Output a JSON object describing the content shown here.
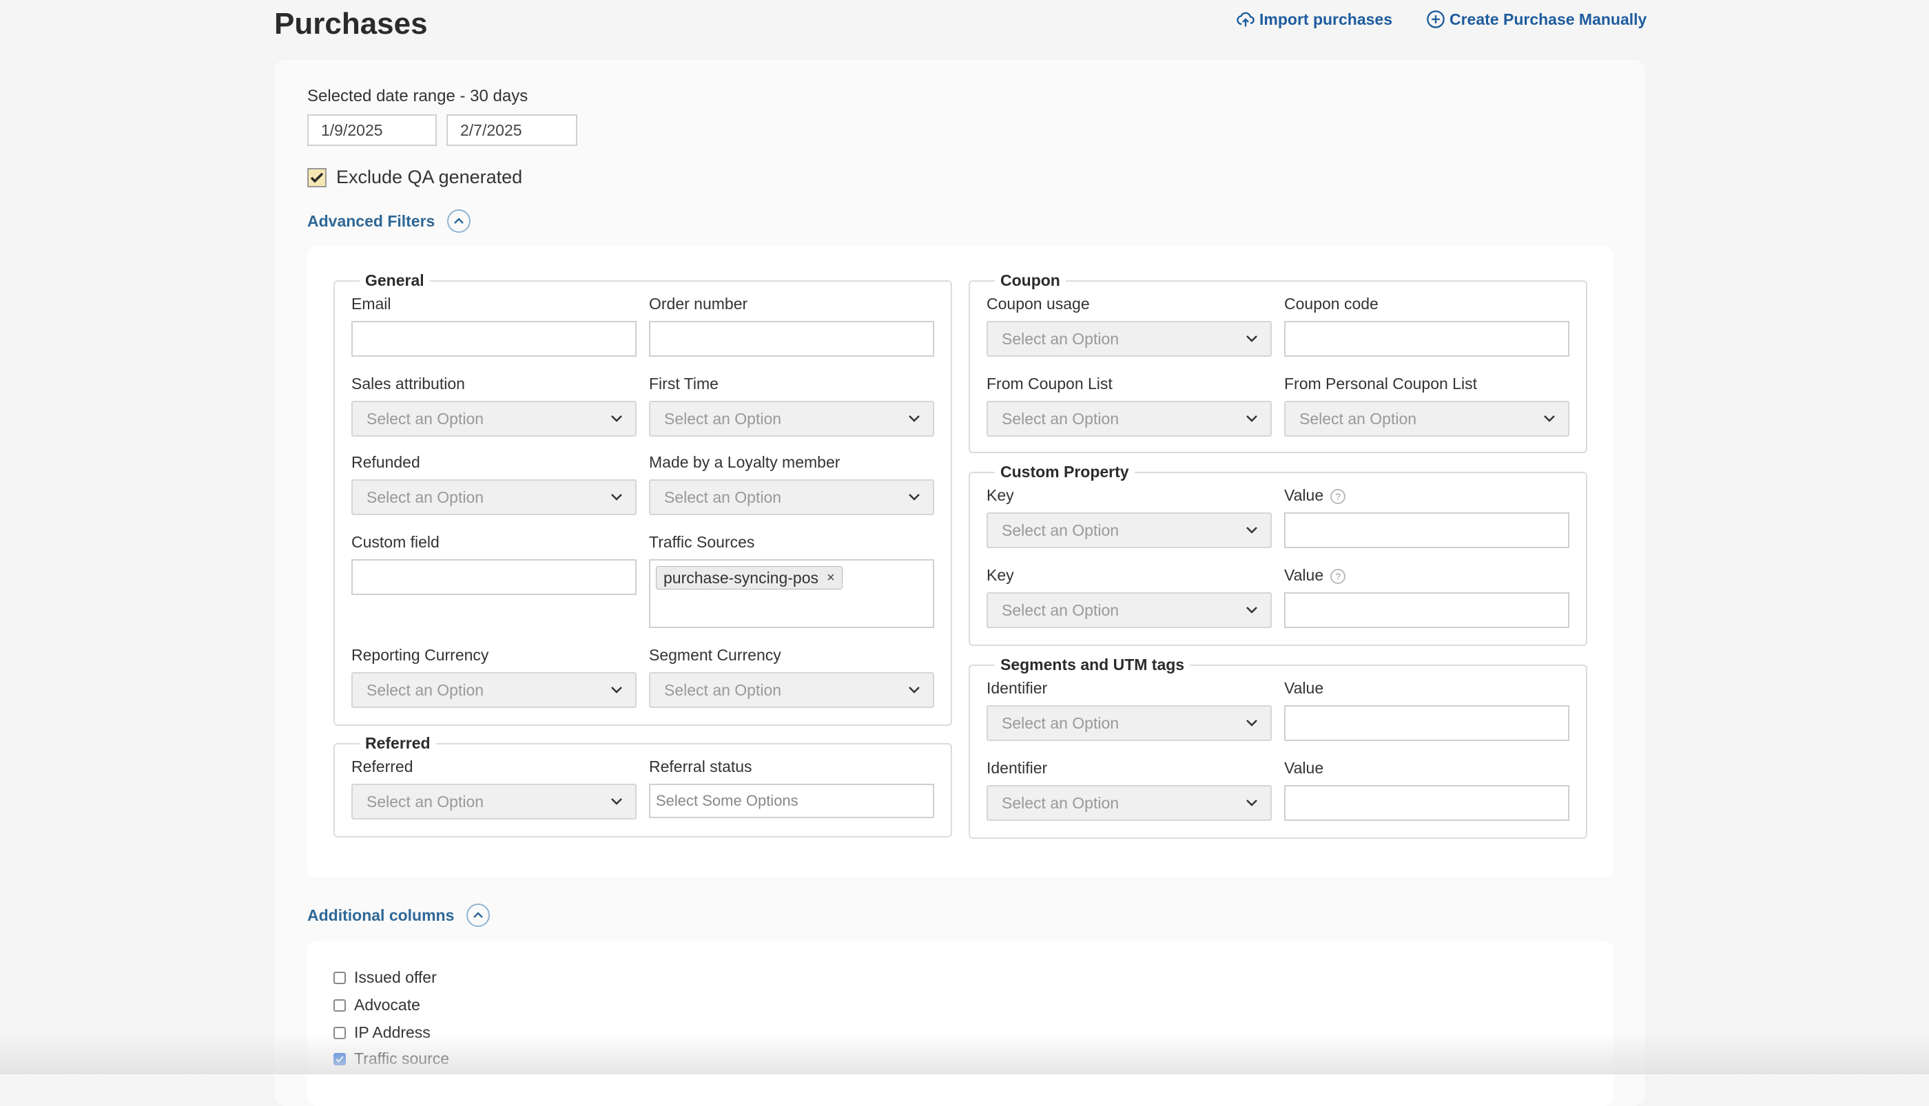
{
  "header": {
    "title": "Purchases",
    "import_label": "Import purchases",
    "create_label": "Create Purchase Manually"
  },
  "date_range": {
    "label": "Selected date range - 30 days",
    "start": "1/9/2025",
    "end": "2/7/2025"
  },
  "exclude_qa": {
    "label": "Exclude QA generated",
    "checked": true
  },
  "advanced_filters": {
    "toggle_label": "Advanced Filters",
    "select_placeholder": "Select an Option",
    "general": {
      "legend": "General",
      "email_label": "Email",
      "order_number_label": "Order number",
      "sales_attribution_label": "Sales attribution",
      "first_time_label": "First Time",
      "refunded_label": "Refunded",
      "loyalty_label": "Made by a Loyalty member",
      "custom_field_label": "Custom field",
      "traffic_sources_label": "Traffic Sources",
      "traffic_sources_selected": [
        "purchase-syncing-pos"
      ],
      "tag_remove": "×",
      "reporting_currency_label": "Reporting Currency",
      "segment_currency_label": "Segment Currency"
    },
    "referred": {
      "legend": "Referred",
      "referred_label": "Referred",
      "referral_status_label": "Referral status",
      "referral_status_placeholder": "Select Some Options"
    },
    "coupon": {
      "legend": "Coupon",
      "usage_label": "Coupon usage",
      "code_label": "Coupon code",
      "list_label": "From Coupon List",
      "personal_list_label": "From Personal Coupon List"
    },
    "custom_property": {
      "legend": "Custom Property",
      "key_label": "Key",
      "value_label": "Value",
      "help": "?"
    },
    "segments_utm": {
      "legend": "Segments and UTM tags",
      "identifier_label": "Identifier",
      "value_label": "Value"
    }
  },
  "additional_columns": {
    "toggle_label": "Additional columns",
    "items": [
      {
        "label": "Issued offer",
        "checked": false
      },
      {
        "label": "Advocate",
        "checked": false
      },
      {
        "label": "IP Address",
        "checked": false
      },
      {
        "label": "Traffic source",
        "checked": true
      }
    ]
  },
  "colors": {
    "link": "#1d5c9e",
    "accent_checkbox": "#2a6fdb",
    "qa_checkbox_bg": "#f6e7b3"
  }
}
